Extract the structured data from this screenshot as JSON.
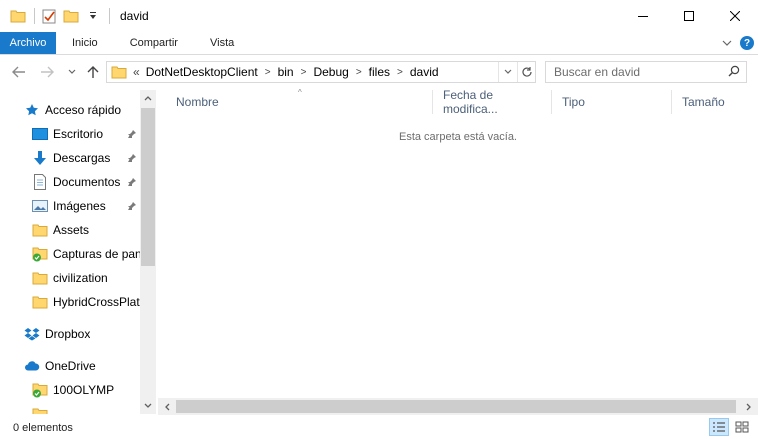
{
  "window": {
    "title": "david"
  },
  "ribbon": {
    "file_tab": "Archivo",
    "tabs": [
      "Inicio",
      "Compartir",
      "Vista"
    ]
  },
  "address": {
    "overflow": "«",
    "crumbs": [
      "DotNetDesktopClient",
      "bin",
      "Debug",
      "files",
      "david"
    ]
  },
  "search": {
    "placeholder": "Buscar en david"
  },
  "nav": {
    "quick_access": "Acceso rápido",
    "items": [
      {
        "label": "Escritorio",
        "pinned": true
      },
      {
        "label": "Descargas",
        "pinned": true
      },
      {
        "label": "Documentos",
        "pinned": true
      },
      {
        "label": "Imágenes",
        "pinned": true
      },
      {
        "label": "Assets",
        "pinned": false
      },
      {
        "label": "Capturas de pan",
        "pinned": false
      },
      {
        "label": "civilization",
        "pinned": false
      },
      {
        "label": "HybridCrossPlat",
        "pinned": false
      }
    ],
    "dropbox": "Dropbox",
    "onedrive": "OneDrive",
    "onedrive_items": [
      "100OLYMP"
    ]
  },
  "columns": [
    "Nombre",
    "Fecha de modifica...",
    "Tipo",
    "Tamaño"
  ],
  "empty_message": "Esta carpeta está vacía.",
  "status": {
    "items_count": "0 elementos"
  },
  "colors": {
    "accent": "#1979ca",
    "folder": "#ffd76e",
    "header_text": "#4c607a"
  }
}
